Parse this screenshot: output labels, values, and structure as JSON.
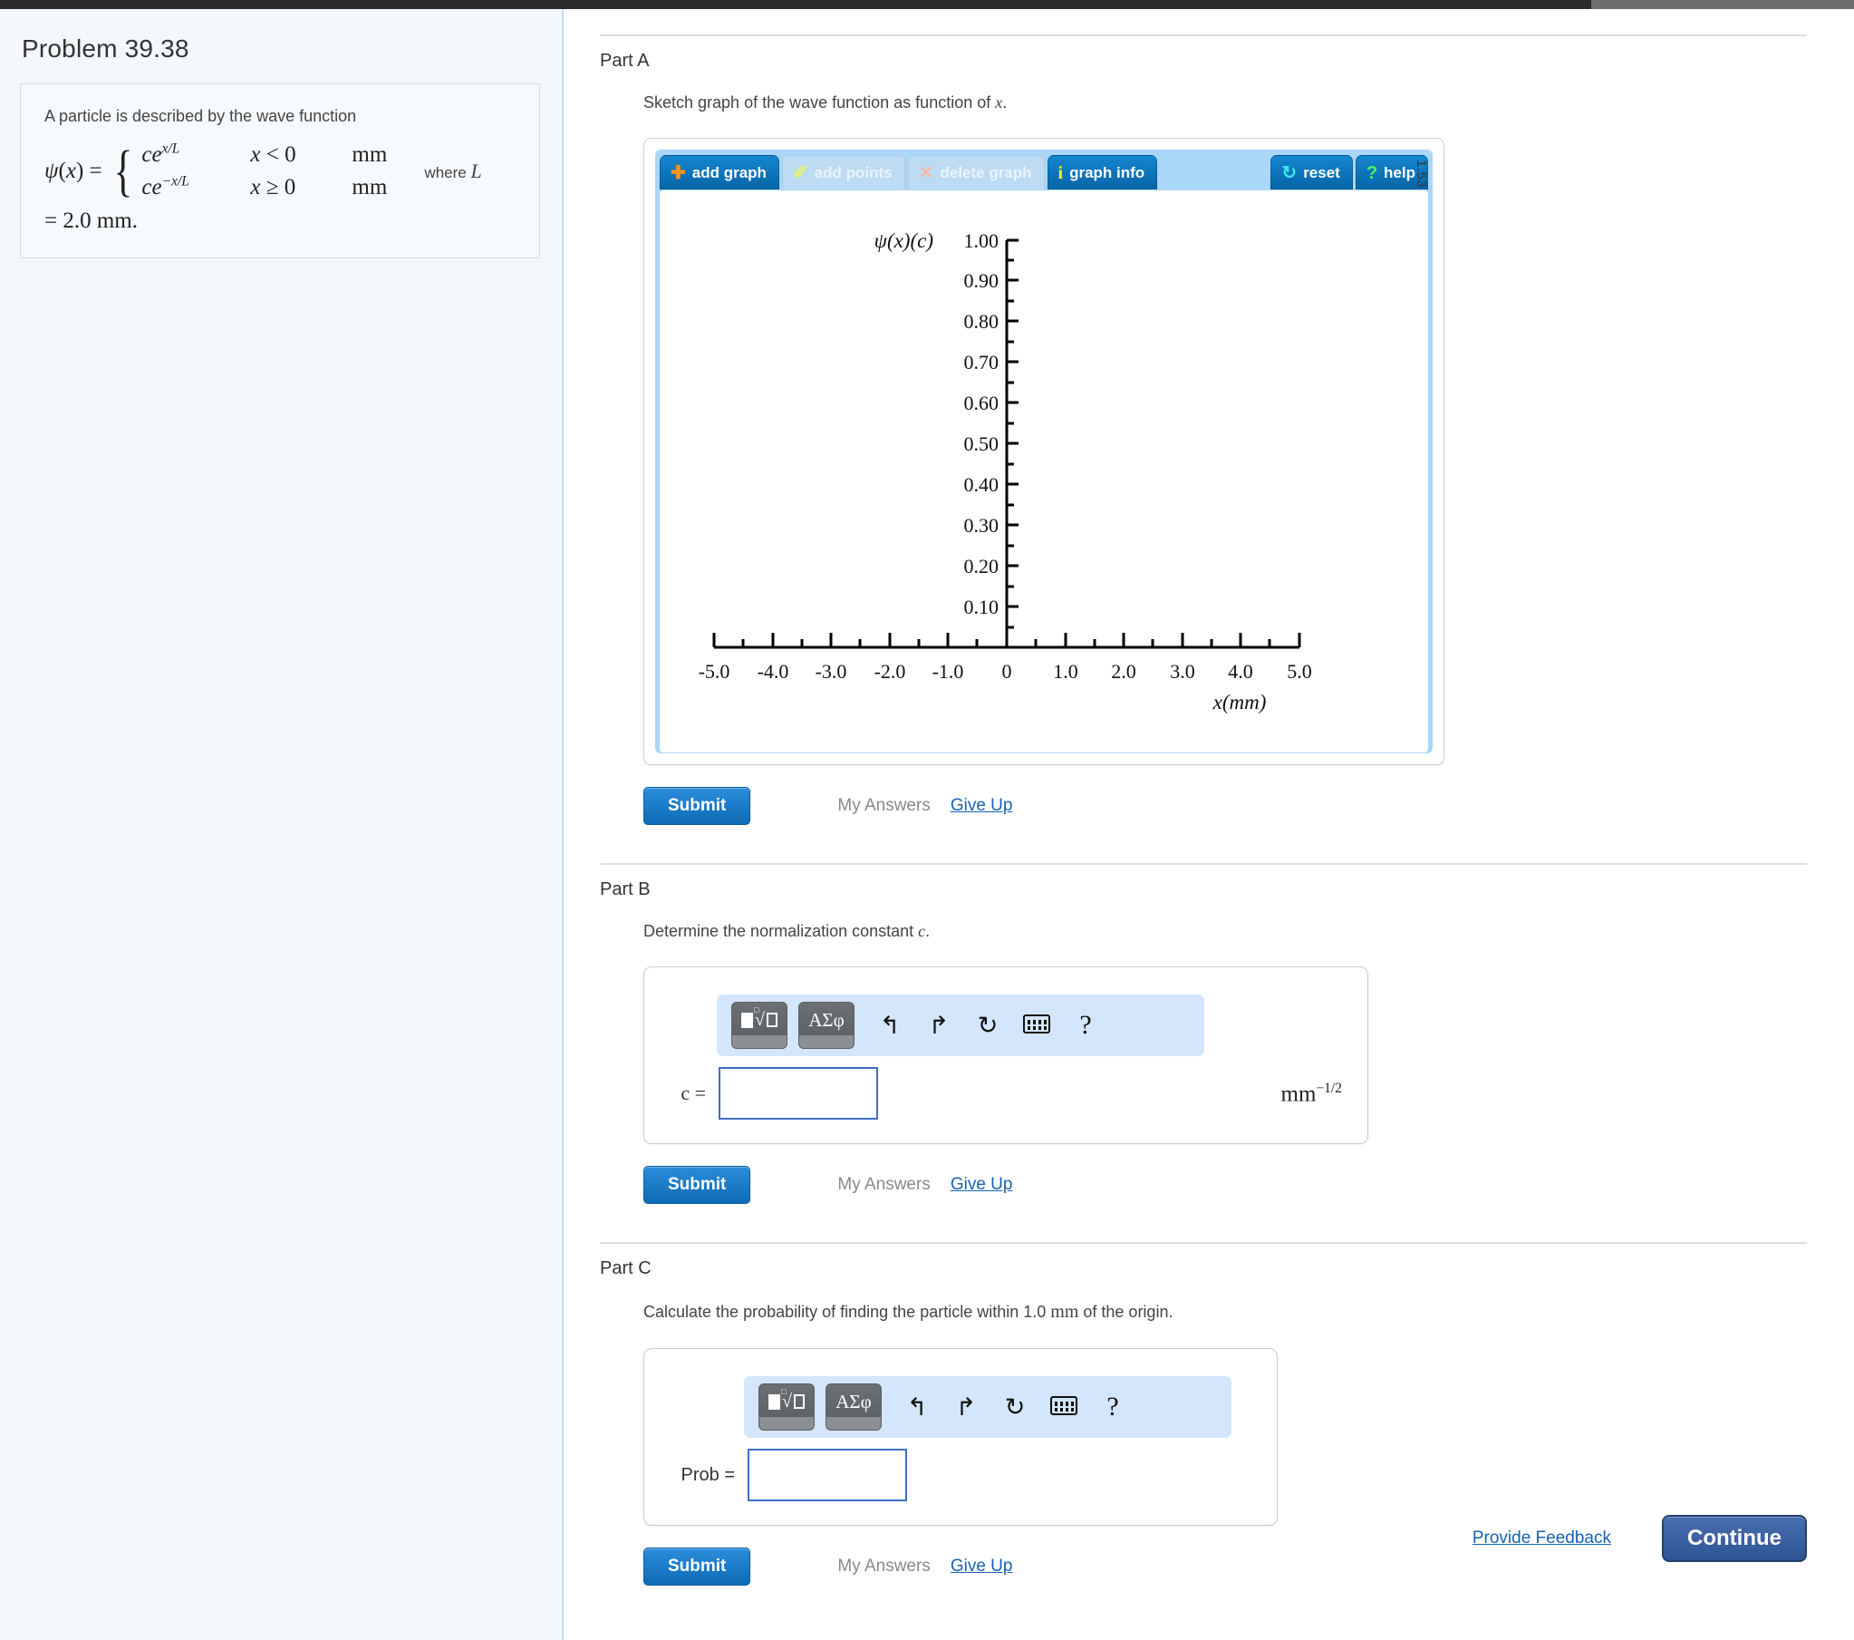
{
  "problem": {
    "title": "Problem 39.38",
    "statement_lead": "A particle is described by the wave function",
    "equation": {
      "lhs": "ψ(x) =",
      "case1_expr": "ce",
      "case1_exp": "x/L",
      "case1_cond": "x < 0",
      "case1_unit": "mm",
      "case2_expr": "ce",
      "case2_exp": "−x/L",
      "case2_cond": "x ≥ 0",
      "case2_unit": "mm",
      "where_text": "where",
      "where_symbol": "L",
      "tail": "= 2.0 mm."
    }
  },
  "parts": {
    "a": {
      "heading": "Part A",
      "question": "Sketch graph of the wave function as function of x.",
      "submit_label": "Submit",
      "my_answers_label": "My Answers",
      "give_up_label": "Give Up"
    },
    "b": {
      "heading": "Part B",
      "question_pre": "Determine the normalization constant ",
      "question_sym": "c",
      "question_post": ".",
      "field_label": "c =",
      "field_value": "",
      "unit_base": "mm",
      "unit_exp": "−1/2",
      "submit_label": "Submit",
      "my_answers_label": "My Answers",
      "give_up_label": "Give Up"
    },
    "c": {
      "heading": "Part C",
      "question_pre": "Calculate the probability of finding the particle within 1.0 ",
      "question_sym": "mm",
      "question_post": " of the origin.",
      "field_label": "Prob =",
      "field_value": "",
      "submit_label": "Submit",
      "my_answers_label": "My Answers",
      "give_up_label": "Give Up"
    }
  },
  "graph_widget": {
    "toolbar": [
      {
        "name": "add-graph",
        "label": "add graph",
        "icon": "plus-icon",
        "glyph": "✚",
        "state": "enabled",
        "icon_color": "#f59324"
      },
      {
        "name": "add-points",
        "label": "add points",
        "icon": "pencil-icon",
        "glyph": "✐",
        "state": "disabled",
        "icon_color": "#dff07a"
      },
      {
        "name": "delete-graph",
        "label": "delete graph",
        "icon": "x-icon",
        "glyph": "✕",
        "state": "disabled",
        "icon_color": "#f3b9a6"
      },
      {
        "name": "graph-info",
        "label": "graph info",
        "icon": "info-icon",
        "glyph": "i",
        "state": "enabled",
        "icon_color": "#fff200"
      },
      {
        "name": "reset",
        "label": "reset",
        "icon": "refresh-icon",
        "glyph": "↻",
        "state": "enabled",
        "icon_color": "#3ee3ef"
      },
      {
        "name": "help",
        "label": "help",
        "icon": "question-icon",
        "glyph": "?",
        "state": "enabled",
        "icon_color": "#49f06a"
      }
    ],
    "scale_readout": "1.53"
  },
  "math_toolbar": {
    "template_button": "template-button",
    "greek_button": "ΑΣφ",
    "undo": "↰",
    "redo": "↱",
    "reset": "↻",
    "keyboard": "keyboard-icon",
    "help": "?"
  },
  "footer": {
    "feedback_label": "Provide Feedback",
    "continue_label": "Continue"
  },
  "chart_data": {
    "type": "line",
    "title": "",
    "xlabel": "x(mm)",
    "ylabel": "ψ(x)(c)",
    "xlim": [
      -5.0,
      5.0
    ],
    "ylim": [
      0.0,
      1.0
    ],
    "x_ticks": [
      "-5.0",
      "-4.0",
      "-3.0",
      "-2.0",
      "-1.0",
      "0",
      "1.0",
      "2.0",
      "3.0",
      "4.0",
      "5.0"
    ],
    "x_tick_values": [
      -5.0,
      -4.0,
      -3.0,
      -2.0,
      -1.0,
      0,
      1.0,
      2.0,
      3.0,
      4.0,
      5.0
    ],
    "x_minor_step": 0.5,
    "y_ticks": [
      "1.00",
      "0.90",
      "0.80",
      "0.70",
      "0.60",
      "0.50",
      "0.40",
      "0.30",
      "0.20",
      "0.10"
    ],
    "y_tick_values": [
      1.0,
      0.9,
      0.8,
      0.7,
      0.6,
      0.5,
      0.4,
      0.3,
      0.2,
      0.1
    ],
    "y_minor_step": 0.05,
    "grid": false,
    "legend": "none",
    "series": [],
    "note": "empty plot canvas - user sketches the wave function"
  }
}
